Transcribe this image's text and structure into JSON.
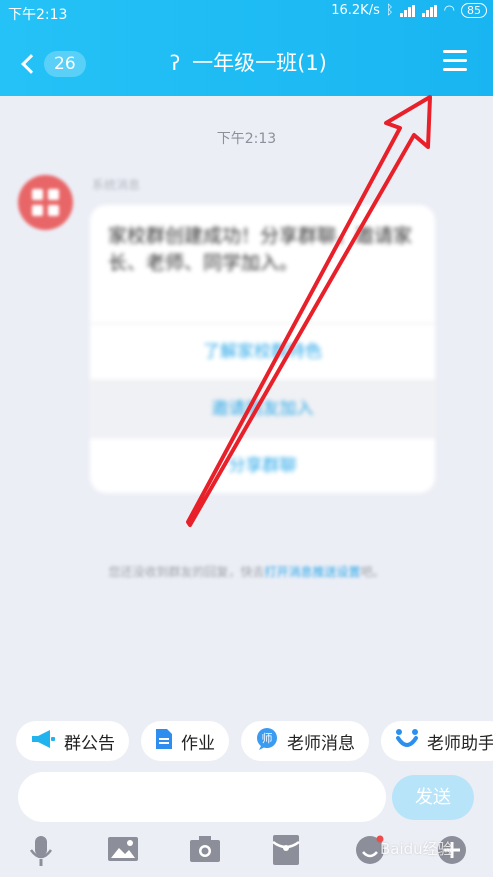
{
  "status_bar": {
    "time": "下午2:13",
    "net_speed": "16.2K/s",
    "battery": "85"
  },
  "nav": {
    "unread_count": "26",
    "title": "一年级一班(1)"
  },
  "chat": {
    "timestamp": "下午2:13",
    "sender": "系统消息",
    "message": "家校群创建成功！分享群聊，邀请家长、老师、同学加入。",
    "actions": [
      "了解家校群特色",
      "邀请朋友加入",
      "分享群聊"
    ],
    "notice_prefix": "您还没收到群友的回复，快去",
    "notice_link": "打开消息推送设置",
    "notice_suffix": "吧。"
  },
  "chips": [
    {
      "label": "群公告",
      "icon": "megaphone-icon",
      "color": "#20b3ee"
    },
    {
      "label": "作业",
      "icon": "document-icon",
      "color": "#2e8ef0"
    },
    {
      "label": "老师消息",
      "icon": "teacher-icon",
      "color": "#3b9bf0"
    },
    {
      "label": "老师助手",
      "icon": "teacher-assistant-icon",
      "color": "#2b8ff0"
    }
  ],
  "composer": {
    "send_label": "发送"
  },
  "watermark": "Baidu经验",
  "colors": {
    "header": "#1fbef5",
    "annotation_arrow": "#e8202a",
    "send_button": "#b7e4f9"
  }
}
